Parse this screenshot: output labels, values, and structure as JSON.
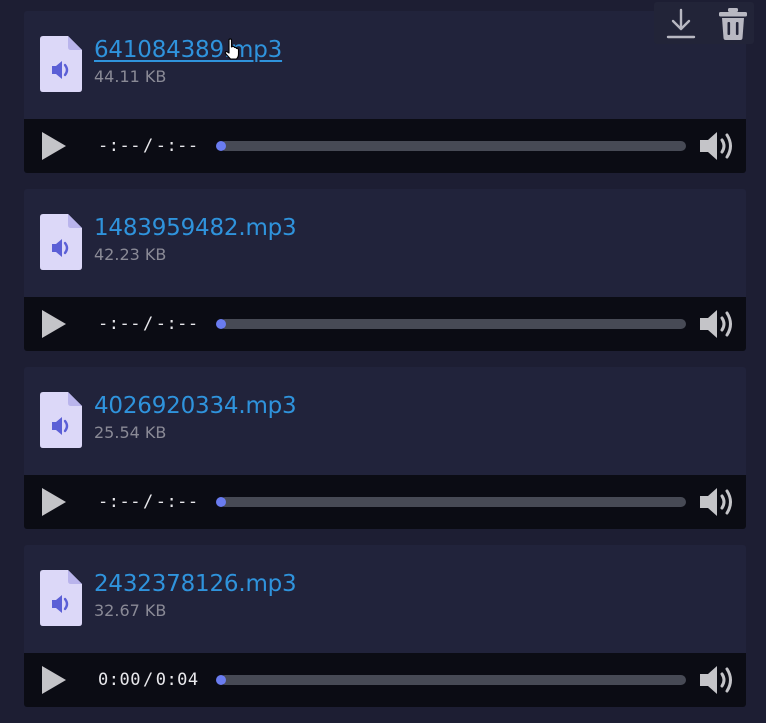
{
  "colors": {
    "background": "#1d1e33",
    "card": "#21233b",
    "player_bar": "#0b0c14",
    "link": "#2f93dc",
    "muted_text": "#8a8a96",
    "icon_accent": "#5b5fd6",
    "file_icon_bg": "#dcd8f8",
    "seek_track": "#474a55",
    "seek_progress": "#6a7cf0"
  },
  "actions": {
    "download_icon": "download-icon",
    "delete_icon": "trash-icon"
  },
  "files": [
    {
      "name": "641084389.mp3",
      "size": "44.11 KB",
      "current_time": "-:--",
      "time_separator": "/",
      "duration": "-:--",
      "progress": 0,
      "hovered": true
    },
    {
      "name": "1483959482.mp3",
      "size": "42.23 KB",
      "current_time": "-:--",
      "time_separator": "/",
      "duration": "-:--",
      "progress": 0,
      "hovered": false
    },
    {
      "name": "4026920334.mp3",
      "size": "25.54 KB",
      "current_time": "-:--",
      "time_separator": "/",
      "duration": "-:--",
      "progress": 0,
      "hovered": false
    },
    {
      "name": "2432378126.mp3",
      "size": "32.67 KB",
      "current_time": "0:00",
      "time_separator": "/",
      "duration": "0:04",
      "progress": 0,
      "hovered": false
    }
  ]
}
